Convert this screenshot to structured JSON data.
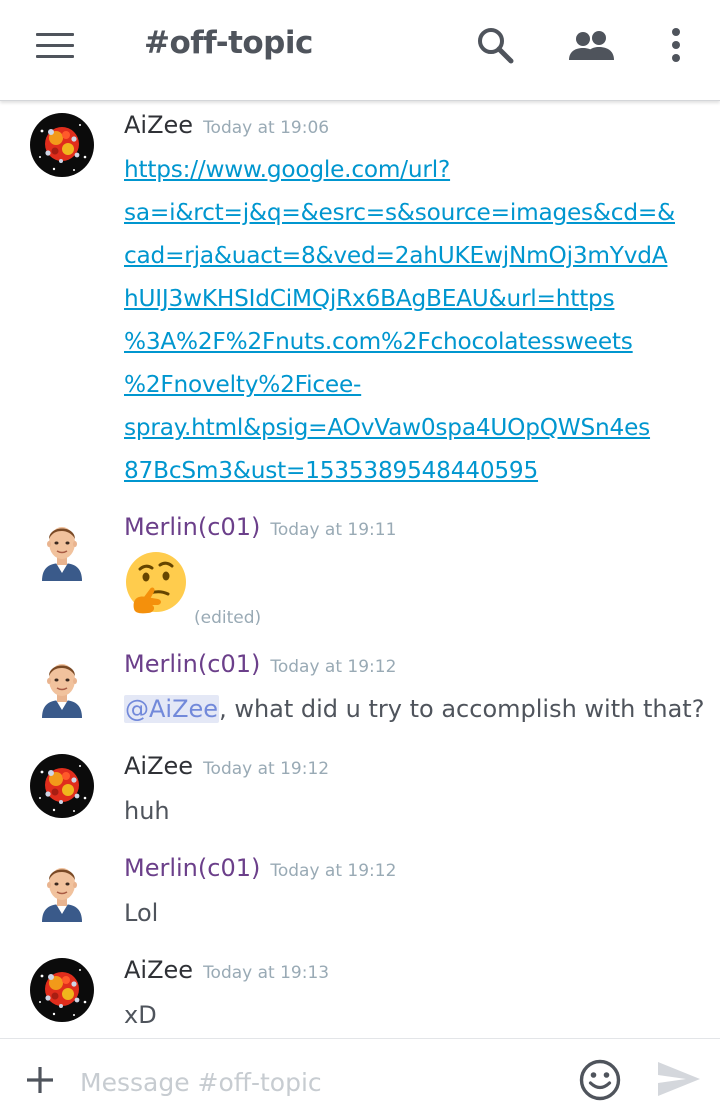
{
  "header": {
    "channel_title": "#off-topic",
    "icons": [
      "menu-icon",
      "search-icon",
      "members-icon",
      "more-vertical-icon"
    ]
  },
  "messages": [
    {
      "author": "AiZee",
      "timestamp": "Today at 19:06",
      "avatar": "planet-avatar",
      "link_lines": [
        "https://www.google.com/url?",
        "sa=i&rct=j&q=&esrc=s&source=images&cd=&",
        "cad=rja&uact=8&ved=2ahUKEwjNmOj3mYvdA",
        "hUIJ3wKHSIdCiMQjRx6BAgBEAU&url=https",
        "%3A%2F%2Fnuts.com%2Fchocolatessweets",
        "%2Fnovelty%2Ficee-",
        "spray.html&psig=AOvVaw0spa4UOpQWSn4es",
        "87BcSm3&ust=1535389548440595"
      ]
    },
    {
      "author": "Merlin(c01)",
      "timestamp": "Today at 19:11",
      "avatar": "bitmoji-man-avatar",
      "emoji": "thinking-face-emoji",
      "edited_label": "(edited)"
    },
    {
      "author": "Merlin(c01)",
      "timestamp": "Today at 19:12",
      "avatar": "bitmoji-man-avatar",
      "mention": "@AiZee",
      "text": ", what did u try to accomplish with that?"
    },
    {
      "author": "AiZee",
      "timestamp": "Today at 19:12",
      "avatar": "planet-avatar",
      "text": "huh"
    },
    {
      "author": "Merlin(c01)",
      "timestamp": "Today at 19:12",
      "avatar": "bitmoji-man-avatar",
      "text": "Lol"
    },
    {
      "author": "AiZee",
      "timestamp": "Today at 19:13",
      "avatar": "planet-avatar",
      "text": "xD"
    }
  ],
  "composer": {
    "placeholder": "Message #off-topic",
    "icons": [
      "plus-icon",
      "emoji-icon",
      "send-icon"
    ]
  },
  "colors": {
    "link": "#0096cf",
    "merlin_name": "#6b3f8a",
    "timestamp": "#99aab5",
    "mention_bg": "#e4e8f6",
    "mention_text": "#7289da",
    "header_icon": "#4f545c"
  }
}
